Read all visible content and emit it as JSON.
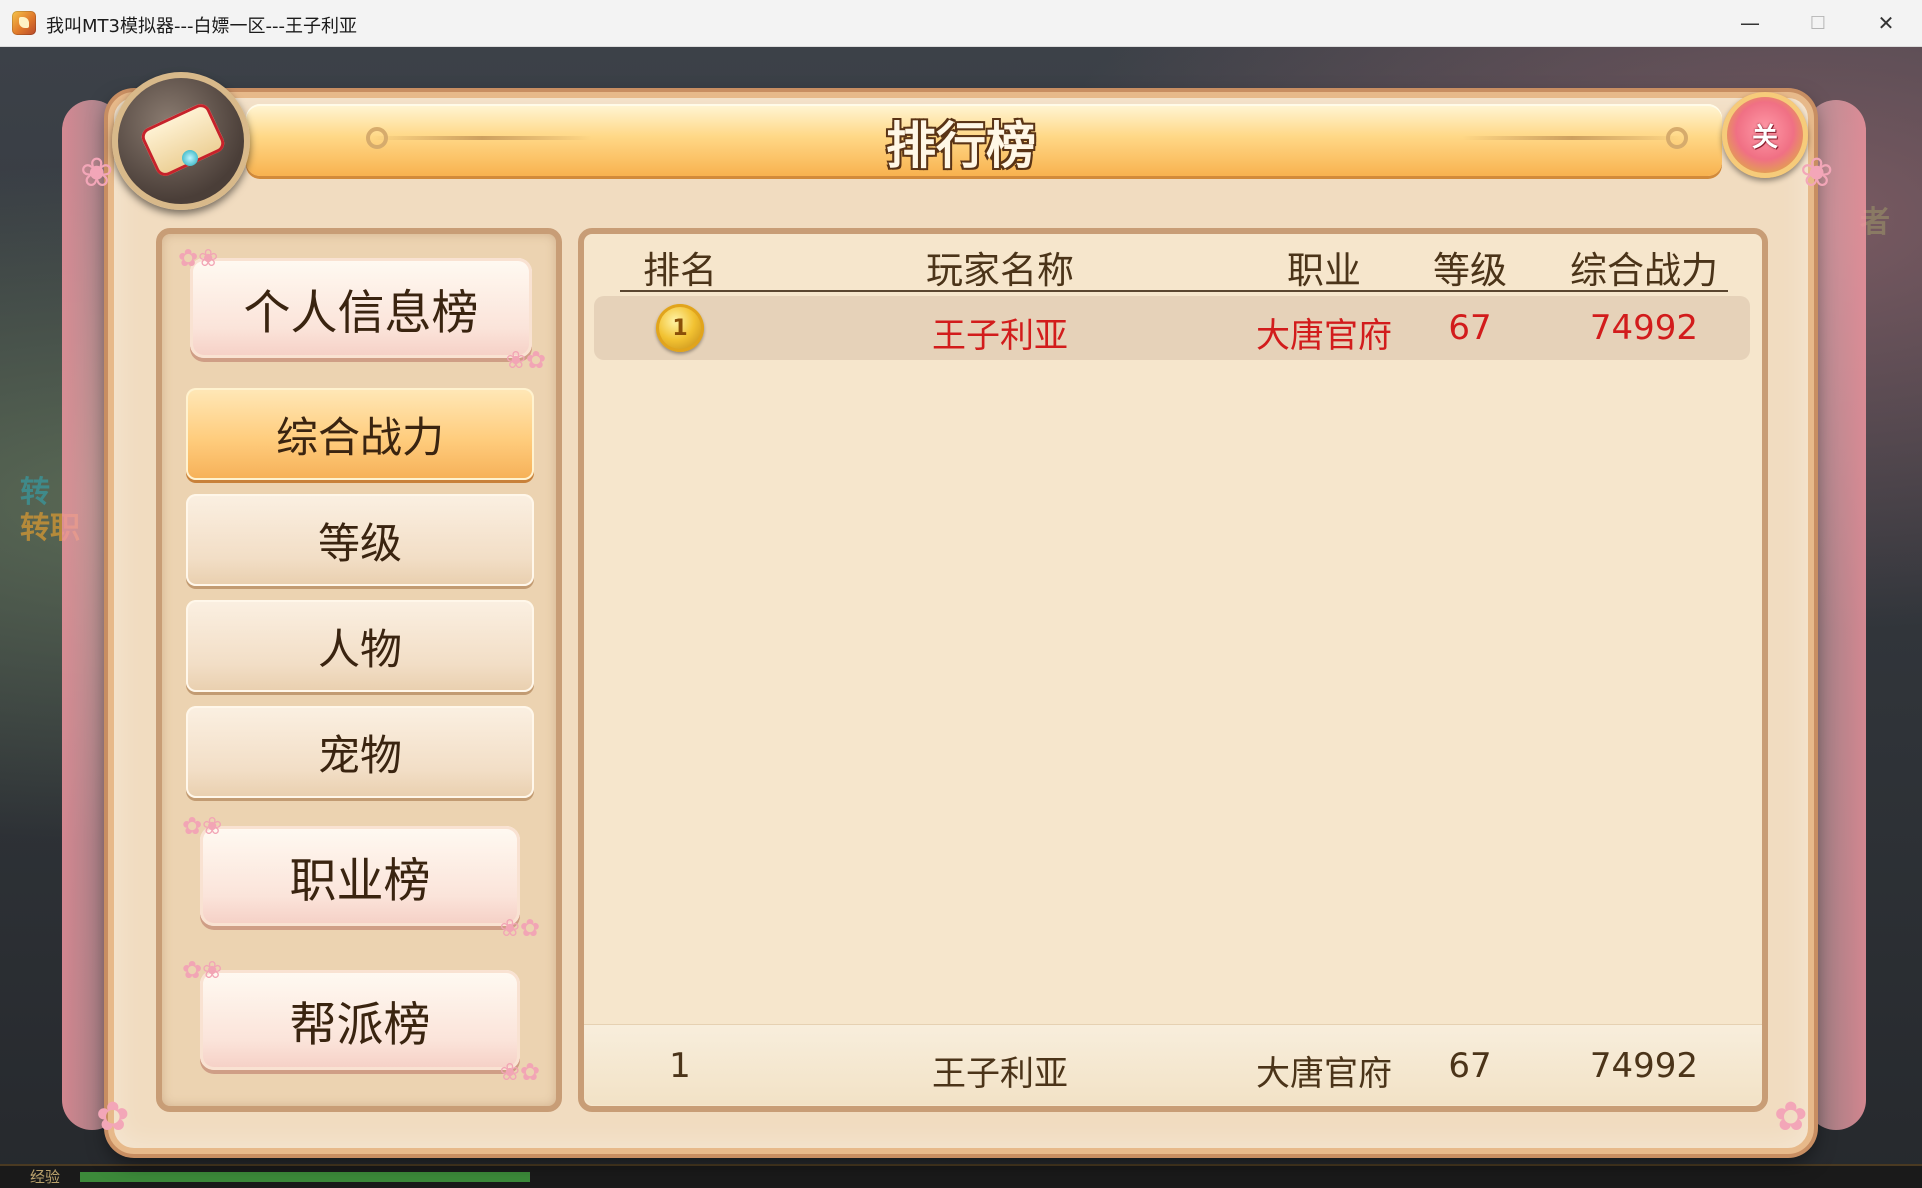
{
  "window": {
    "title": "我叫MT3模拟器---白嫖一区---王子利亚",
    "controls": {
      "minimize": "—",
      "maximize": "☐",
      "close": "✕"
    }
  },
  "background": {
    "side_text_1": "转",
    "side_text_2": "转职",
    "right_text": "者",
    "exp_label": "经验"
  },
  "panel": {
    "title": "排行榜",
    "close_label": "关"
  },
  "nav": {
    "personal_label": "个人信息榜",
    "personal_items": [
      {
        "label": "综合战力",
        "active": true
      },
      {
        "label": "等级",
        "active": false
      },
      {
        "label": "人物",
        "active": false
      },
      {
        "label": "宠物",
        "active": false
      }
    ],
    "profession_label": "职业榜",
    "guild_label": "帮派榜"
  },
  "table": {
    "columns": [
      "排名",
      "玩家名称",
      "职业",
      "等级",
      "综合战力"
    ],
    "rows": [
      {
        "rank": "1",
        "name": "王子利亚",
        "profession": "大唐官府",
        "level": "67",
        "power": "74992"
      }
    ],
    "self_row": {
      "rank": "1",
      "name": "王子利亚",
      "profession": "大唐官府",
      "level": "67",
      "power": "74992"
    }
  }
}
